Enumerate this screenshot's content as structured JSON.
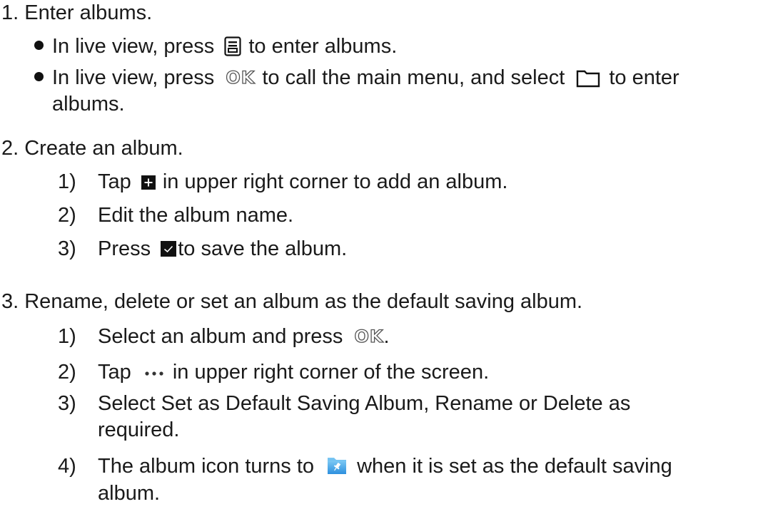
{
  "step1": {
    "title": "1. Enter albums.",
    "b1_pre": "In live view, press",
    "b1_post": "to enter albums.",
    "b2_pre": "In live view, press",
    "b2_mid": "to call the main menu, and select",
    "b2_post": "to enter",
    "b2_cont": "albums."
  },
  "step2": {
    "title": "2. Create an album.",
    "items": [
      {
        "num": "1)",
        "pre": "Tap",
        "post": "in upper right corner to add an album."
      },
      {
        "num": "2)",
        "text": "Edit the album name."
      },
      {
        "num": "3)",
        "pre": "Press",
        "post": "to save the album."
      }
    ]
  },
  "step3": {
    "title": "3. Rename, delete or set an album as the default saving album.",
    "items": [
      {
        "num": "1)",
        "pre": "Select an album and press",
        "post": "."
      },
      {
        "num": "2)",
        "pre": "Tap",
        "post": "in upper right corner of the screen."
      },
      {
        "num": "3)",
        "text": "Select Set as Default Saving Album, Rename or Delete as",
        "cont": "required."
      },
      {
        "num": "4)",
        "pre": "The album icon turns to",
        "post": "when it is set as the default saving",
        "cont": "album."
      }
    ]
  },
  "glyphs": {
    "ok": "OK"
  },
  "icons": {
    "albums": "album-list-icon",
    "folder": "folder-icon",
    "add": "plus-square-icon",
    "confirm": "checkmark-square-icon",
    "more": "more-dots-icon",
    "default_album": "pinned-album-icon"
  },
  "colors": {
    "text": "#1a1a1a",
    "icon_dark": "#111111",
    "pinned_album": "#3aa0e6"
  }
}
